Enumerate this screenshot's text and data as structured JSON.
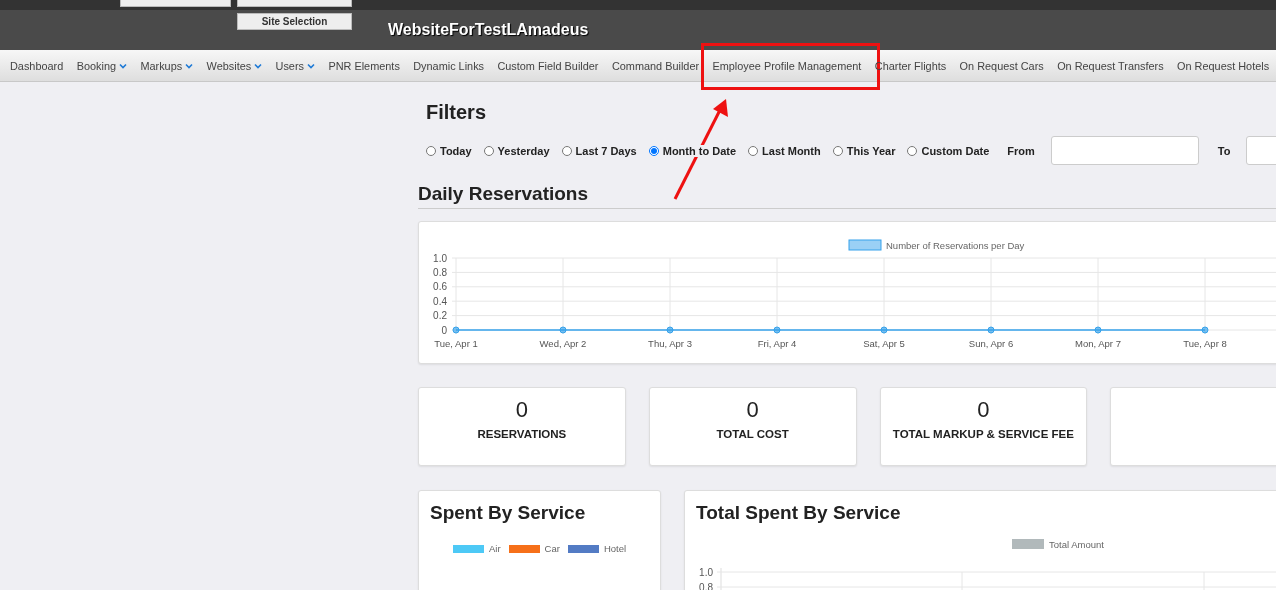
{
  "header": {
    "site_buttons": [
      {
        "kind": "cut-off"
      },
      {
        "kind": "cut-off"
      },
      {
        "kind": "button",
        "label": "Site Selection"
      }
    ],
    "title": "WebsiteForTestLAmadeus"
  },
  "nav": {
    "items": [
      {
        "label": "Dashboard",
        "dropdown": false,
        "highlighted": false
      },
      {
        "label": "Booking",
        "dropdown": true,
        "highlighted": false
      },
      {
        "label": "Markups",
        "dropdown": true,
        "highlighted": false
      },
      {
        "label": "Websites",
        "dropdown": true,
        "highlighted": false
      },
      {
        "label": "Users",
        "dropdown": true,
        "highlighted": false
      },
      {
        "label": "PNR Elements",
        "dropdown": false,
        "highlighted": false
      },
      {
        "label": "Dynamic Links",
        "dropdown": false,
        "highlighted": false
      },
      {
        "label": "Custom Field Builder",
        "dropdown": false,
        "highlighted": false
      },
      {
        "label": "Command Builder",
        "dropdown": false,
        "highlighted": false
      },
      {
        "label": "Employee Profile Management",
        "dropdown": false,
        "highlighted": true
      },
      {
        "label": "Charter Flights",
        "dropdown": false,
        "highlighted": false
      },
      {
        "label": "On Request Cars",
        "dropdown": false,
        "highlighted": false
      },
      {
        "label": "On Request Transfers",
        "dropdown": false,
        "highlighted": false
      },
      {
        "label": "On Request Hotels",
        "dropdown": false,
        "highlighted": false
      }
    ]
  },
  "filters": {
    "title": "Filters",
    "options": [
      {
        "label": "Today",
        "selected": false
      },
      {
        "label": "Yesterday",
        "selected": false
      },
      {
        "label": "Last 7 Days",
        "selected": false
      },
      {
        "label": "Month to Date",
        "selected": true
      },
      {
        "label": "Last Month",
        "selected": false
      },
      {
        "label": "This Year",
        "selected": false
      },
      {
        "label": "Custom Date",
        "selected": false
      }
    ],
    "from": {
      "label": "From"
    },
    "to": {
      "label": "To"
    }
  },
  "daily_reservations": {
    "title": "Daily Reservations",
    "chart_data": {
      "type": "line",
      "categories": [
        "Tue, Apr 1",
        "Wed, Apr 2",
        "Thu, Apr 3",
        "Fri, Apr 4",
        "Sat, Apr 5",
        "Sun, Apr 6",
        "Mon, Apr 7",
        "Tue, Apr 8"
      ],
      "series": [
        {
          "name": "Number of Reservations per Day",
          "color": "#36a2eb",
          "values": [
            0,
            0,
            0,
            0,
            0,
            0,
            0,
            0
          ],
          "marker": true
        }
      ],
      "grid": true,
      "ylim": [
        0,
        1
      ],
      "yticks": [
        0,
        0.2,
        0.4,
        0.6,
        0.8,
        {
          "value": 1,
          "label": "1.0"
        }
      ]
    }
  },
  "stats": [
    {
      "kind": "stat",
      "value": "0",
      "label": "RESERVATIONS"
    },
    {
      "kind": "stat",
      "value": "0",
      "label": "TOTAL COST"
    },
    {
      "kind": "stat",
      "value": "0",
      "label": "TOTAL MARKUP & SERVICE FEE"
    },
    {
      "kind": "cut-off"
    }
  ],
  "spent_by_service": {
    "title": "Spent By Service",
    "legend": [
      {
        "label": "Air",
        "color": "#4dc9f6"
      },
      {
        "label": "Car",
        "color": "#f67019"
      },
      {
        "label": "Hotel",
        "color": "#537bc4"
      }
    ]
  },
  "total_spent_by_service": {
    "title": "Total Spent By Service",
    "chart_data": {
      "type": "bar",
      "series": [
        {
          "name": "Total Amount",
          "color": "#b1b9bb"
        }
      ],
      "grid": true,
      "ylim": [
        0,
        1
      ],
      "yticks": [
        0.8,
        {
          "value": 1,
          "label": "1.0"
        }
      ]
    }
  }
}
